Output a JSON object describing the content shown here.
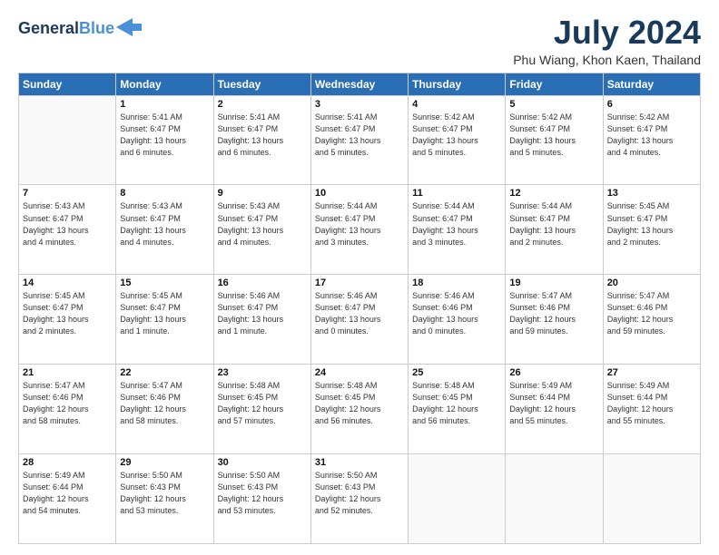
{
  "header": {
    "logo_line1": "General",
    "logo_line2": "Blue",
    "month": "July 2024",
    "location": "Phu Wiang, Khon Kaen, Thailand"
  },
  "weekdays": [
    "Sunday",
    "Monday",
    "Tuesday",
    "Wednesday",
    "Thursday",
    "Friday",
    "Saturday"
  ],
  "weeks": [
    [
      {
        "day": "",
        "info": ""
      },
      {
        "day": "1",
        "info": "Sunrise: 5:41 AM\nSunset: 6:47 PM\nDaylight: 13 hours\nand 6 minutes."
      },
      {
        "day": "2",
        "info": "Sunrise: 5:41 AM\nSunset: 6:47 PM\nDaylight: 13 hours\nand 6 minutes."
      },
      {
        "day": "3",
        "info": "Sunrise: 5:41 AM\nSunset: 6:47 PM\nDaylight: 13 hours\nand 5 minutes."
      },
      {
        "day": "4",
        "info": "Sunrise: 5:42 AM\nSunset: 6:47 PM\nDaylight: 13 hours\nand 5 minutes."
      },
      {
        "day": "5",
        "info": "Sunrise: 5:42 AM\nSunset: 6:47 PM\nDaylight: 13 hours\nand 5 minutes."
      },
      {
        "day": "6",
        "info": "Sunrise: 5:42 AM\nSunset: 6:47 PM\nDaylight: 13 hours\nand 4 minutes."
      }
    ],
    [
      {
        "day": "7",
        "info": "Sunrise: 5:43 AM\nSunset: 6:47 PM\nDaylight: 13 hours\nand 4 minutes."
      },
      {
        "day": "8",
        "info": "Sunrise: 5:43 AM\nSunset: 6:47 PM\nDaylight: 13 hours\nand 4 minutes."
      },
      {
        "day": "9",
        "info": "Sunrise: 5:43 AM\nSunset: 6:47 PM\nDaylight: 13 hours\nand 4 minutes."
      },
      {
        "day": "10",
        "info": "Sunrise: 5:44 AM\nSunset: 6:47 PM\nDaylight: 13 hours\nand 3 minutes."
      },
      {
        "day": "11",
        "info": "Sunrise: 5:44 AM\nSunset: 6:47 PM\nDaylight: 13 hours\nand 3 minutes."
      },
      {
        "day": "12",
        "info": "Sunrise: 5:44 AM\nSunset: 6:47 PM\nDaylight: 13 hours\nand 2 minutes."
      },
      {
        "day": "13",
        "info": "Sunrise: 5:45 AM\nSunset: 6:47 PM\nDaylight: 13 hours\nand 2 minutes."
      }
    ],
    [
      {
        "day": "14",
        "info": "Sunrise: 5:45 AM\nSunset: 6:47 PM\nDaylight: 13 hours\nand 2 minutes."
      },
      {
        "day": "15",
        "info": "Sunrise: 5:45 AM\nSunset: 6:47 PM\nDaylight: 13 hours\nand 1 minute."
      },
      {
        "day": "16",
        "info": "Sunrise: 5:46 AM\nSunset: 6:47 PM\nDaylight: 13 hours\nand 1 minute."
      },
      {
        "day": "17",
        "info": "Sunrise: 5:46 AM\nSunset: 6:47 PM\nDaylight: 13 hours\nand 0 minutes."
      },
      {
        "day": "18",
        "info": "Sunrise: 5:46 AM\nSunset: 6:46 PM\nDaylight: 13 hours\nand 0 minutes."
      },
      {
        "day": "19",
        "info": "Sunrise: 5:47 AM\nSunset: 6:46 PM\nDaylight: 12 hours\nand 59 minutes."
      },
      {
        "day": "20",
        "info": "Sunrise: 5:47 AM\nSunset: 6:46 PM\nDaylight: 12 hours\nand 59 minutes."
      }
    ],
    [
      {
        "day": "21",
        "info": "Sunrise: 5:47 AM\nSunset: 6:46 PM\nDaylight: 12 hours\nand 58 minutes."
      },
      {
        "day": "22",
        "info": "Sunrise: 5:47 AM\nSunset: 6:46 PM\nDaylight: 12 hours\nand 58 minutes."
      },
      {
        "day": "23",
        "info": "Sunrise: 5:48 AM\nSunset: 6:45 PM\nDaylight: 12 hours\nand 57 minutes."
      },
      {
        "day": "24",
        "info": "Sunrise: 5:48 AM\nSunset: 6:45 PM\nDaylight: 12 hours\nand 56 minutes."
      },
      {
        "day": "25",
        "info": "Sunrise: 5:48 AM\nSunset: 6:45 PM\nDaylight: 12 hours\nand 56 minutes."
      },
      {
        "day": "26",
        "info": "Sunrise: 5:49 AM\nSunset: 6:44 PM\nDaylight: 12 hours\nand 55 minutes."
      },
      {
        "day": "27",
        "info": "Sunrise: 5:49 AM\nSunset: 6:44 PM\nDaylight: 12 hours\nand 55 minutes."
      }
    ],
    [
      {
        "day": "28",
        "info": "Sunrise: 5:49 AM\nSunset: 6:44 PM\nDaylight: 12 hours\nand 54 minutes."
      },
      {
        "day": "29",
        "info": "Sunrise: 5:50 AM\nSunset: 6:43 PM\nDaylight: 12 hours\nand 53 minutes."
      },
      {
        "day": "30",
        "info": "Sunrise: 5:50 AM\nSunset: 6:43 PM\nDaylight: 12 hours\nand 53 minutes."
      },
      {
        "day": "31",
        "info": "Sunrise: 5:50 AM\nSunset: 6:43 PM\nDaylight: 12 hours\nand 52 minutes."
      },
      {
        "day": "",
        "info": ""
      },
      {
        "day": "",
        "info": ""
      },
      {
        "day": "",
        "info": ""
      }
    ]
  ]
}
